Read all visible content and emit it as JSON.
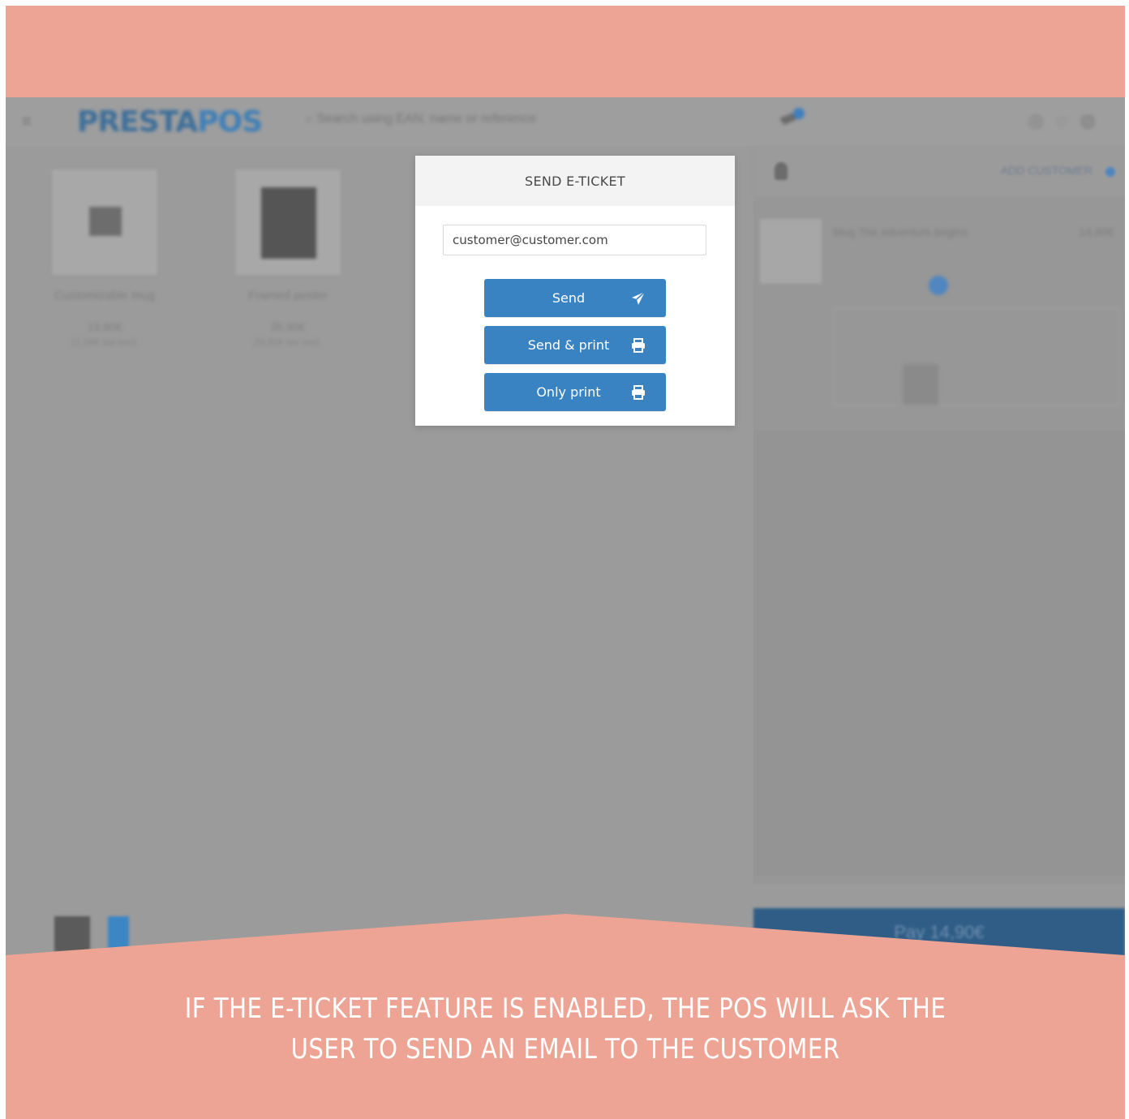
{
  "colors": {
    "banner": "#eea494",
    "button": "#3a83c2",
    "overlay": "#9b9b9b"
  },
  "background_app": {
    "logo": {
      "part1": "PRESTA",
      "part2": "POS"
    },
    "search_placeholder": "Search using EAN, name or reference",
    "products": [
      {
        "name": "Customizable mug",
        "price": "13,90€",
        "sub": "11,58€ tax excl."
      },
      {
        "name": "Framed poster",
        "price": "35,90€",
        "sub": "29,92€ tax excl."
      }
    ],
    "customer": {
      "add_label": "ADD CUSTOMER"
    },
    "pay_label": "Pay 14,90€"
  },
  "dialog": {
    "title": "SEND E-TICKET",
    "email_value": "customer@customer.com",
    "buttons": {
      "send": "Send",
      "send_print": "Send & print",
      "only_print": "Only print"
    },
    "icons": {
      "send": "paper-plane-icon",
      "send_print": "printer-icon",
      "only_print": "printer-icon"
    }
  },
  "caption": {
    "line1": "IF THE E-TICKET FEATURE IS ENABLED, THE POS WILL ASK THE",
    "line2": "USER TO SEND AN EMAIL TO THE CUSTOMER"
  }
}
